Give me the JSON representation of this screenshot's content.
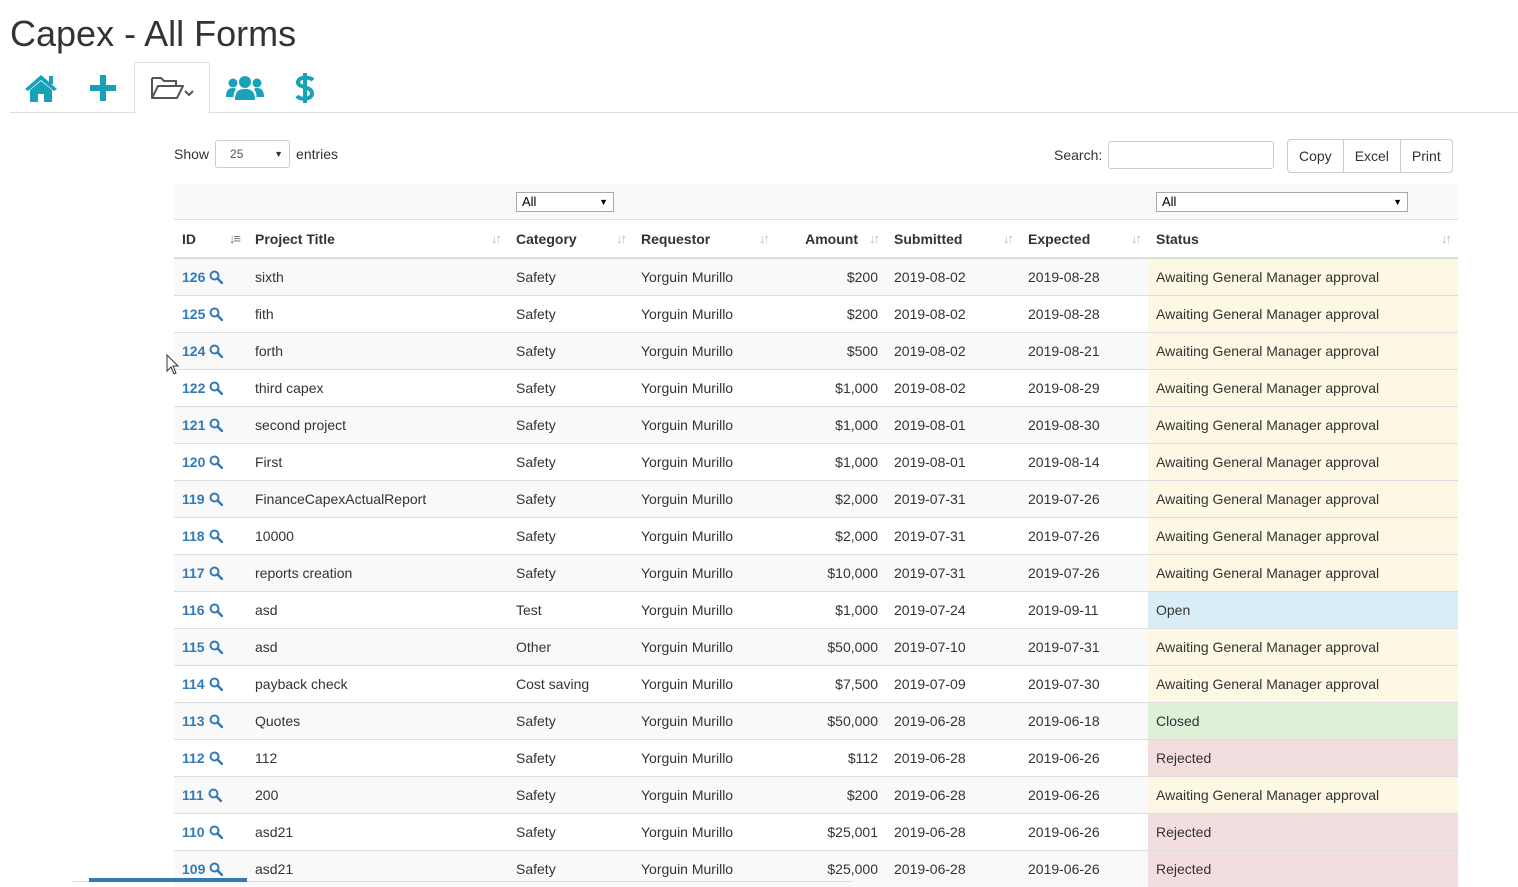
{
  "page": {
    "title": "Capex - All Forms"
  },
  "toolbar": {
    "tabs": [
      {
        "icon": "home-icon"
      },
      {
        "icon": "plus-icon"
      },
      {
        "icon": "folder-open-icon",
        "active": true
      },
      {
        "icon": "users-icon"
      },
      {
        "icon": "dollar-icon"
      }
    ],
    "accent_color": "#17a2b8"
  },
  "controls": {
    "show_label": "Show",
    "entries_value": "25",
    "entries_label": "entries",
    "search_label": "Search:",
    "search_value": "",
    "buttons": [
      "Copy",
      "Excel",
      "Print"
    ]
  },
  "filters": {
    "category": "All",
    "status": "All"
  },
  "table": {
    "columns": [
      "ID",
      "Project Title",
      "Category",
      "Requestor",
      "Amount",
      "Submitted",
      "Expected",
      "Status"
    ],
    "rows": [
      {
        "id": "126",
        "title": "sixth",
        "category": "Safety",
        "requestor": "Yorguin Murillo",
        "amount": "$200",
        "submitted": "2019-08-02",
        "expected": "2019-08-28",
        "status": "Awaiting General Manager approval",
        "status_type": "warning"
      },
      {
        "id": "125",
        "title": "fith",
        "category": "Safety",
        "requestor": "Yorguin Murillo",
        "amount": "$200",
        "submitted": "2019-08-02",
        "expected": "2019-08-28",
        "status": "Awaiting General Manager approval",
        "status_type": "warning"
      },
      {
        "id": "124",
        "title": "forth",
        "category": "Safety",
        "requestor": "Yorguin Murillo",
        "amount": "$500",
        "submitted": "2019-08-02",
        "expected": "2019-08-21",
        "status": "Awaiting General Manager approval",
        "status_type": "warning"
      },
      {
        "id": "122",
        "title": "third capex",
        "category": "Safety",
        "requestor": "Yorguin Murillo",
        "amount": "$1,000",
        "submitted": "2019-08-02",
        "expected": "2019-08-29",
        "status": "Awaiting General Manager approval",
        "status_type": "warning"
      },
      {
        "id": "121",
        "title": "second project",
        "category": "Safety",
        "requestor": "Yorguin Murillo",
        "amount": "$1,000",
        "submitted": "2019-08-01",
        "expected": "2019-08-30",
        "status": "Awaiting General Manager approval",
        "status_type": "warning"
      },
      {
        "id": "120",
        "title": "First",
        "category": "Safety",
        "requestor": "Yorguin Murillo",
        "amount": "$1,000",
        "submitted": "2019-08-01",
        "expected": "2019-08-14",
        "status": "Awaiting General Manager approval",
        "status_type": "warning"
      },
      {
        "id": "119",
        "title": "FinanceCapexActualReport",
        "category": "Safety",
        "requestor": "Yorguin Murillo",
        "amount": "$2,000",
        "submitted": "2019-07-31",
        "expected": "2019-07-26",
        "status": "Awaiting General Manager approval",
        "status_type": "warning"
      },
      {
        "id": "118",
        "title": "10000",
        "category": "Safety",
        "requestor": "Yorguin Murillo",
        "amount": "$2,000",
        "submitted": "2019-07-31",
        "expected": "2019-07-26",
        "status": "Awaiting General Manager approval",
        "status_type": "warning"
      },
      {
        "id": "117",
        "title": "reports creation",
        "category": "Safety",
        "requestor": "Yorguin Murillo",
        "amount": "$10,000",
        "submitted": "2019-07-31",
        "expected": "2019-07-26",
        "status": "Awaiting General Manager approval",
        "status_type": "warning"
      },
      {
        "id": "116",
        "title": "asd",
        "category": "Test",
        "requestor": "Yorguin Murillo",
        "amount": "$1,000",
        "submitted": "2019-07-24",
        "expected": "2019-09-11",
        "status": "Open",
        "status_type": "info"
      },
      {
        "id": "115",
        "title": "asd",
        "category": "Other",
        "requestor": "Yorguin Murillo",
        "amount": "$50,000",
        "submitted": "2019-07-10",
        "expected": "2019-07-31",
        "status": "Awaiting General Manager approval",
        "status_type": "warning"
      },
      {
        "id": "114",
        "title": "payback check",
        "category": "Cost saving",
        "requestor": "Yorguin Murillo",
        "amount": "$7,500",
        "submitted": "2019-07-09",
        "expected": "2019-07-30",
        "status": "Awaiting General Manager approval",
        "status_type": "warning"
      },
      {
        "id": "113",
        "title": "Quotes",
        "category": "Safety",
        "requestor": "Yorguin Murillo",
        "amount": "$50,000",
        "submitted": "2019-06-28",
        "expected": "2019-06-18",
        "status": "Closed",
        "status_type": "success"
      },
      {
        "id": "112",
        "title": "112",
        "category": "Safety",
        "requestor": "Yorguin Murillo",
        "amount": "$112",
        "submitted": "2019-06-28",
        "expected": "2019-06-26",
        "status": "Rejected",
        "status_type": "danger"
      },
      {
        "id": "111",
        "title": "200",
        "category": "Safety",
        "requestor": "Yorguin Murillo",
        "amount": "$200",
        "submitted": "2019-06-28",
        "expected": "2019-06-26",
        "status": "Awaiting General Manager approval",
        "status_type": "warning"
      },
      {
        "id": "110",
        "title": "asd21",
        "category": "Safety",
        "requestor": "Yorguin Murillo",
        "amount": "$25,001",
        "submitted": "2019-06-28",
        "expected": "2019-06-26",
        "status": "Rejected",
        "status_type": "danger"
      },
      {
        "id": "109",
        "title": "asd21",
        "category": "Safety",
        "requestor": "Yorguin Murillo",
        "amount": "$25,000",
        "submitted": "2019-06-28",
        "expected": "2019-06-26",
        "status": "Rejected",
        "status_type": "danger"
      }
    ]
  }
}
